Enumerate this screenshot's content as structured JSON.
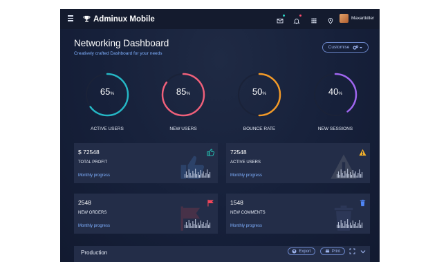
{
  "header": {
    "brand": "Adminux Mobile",
    "username": "Maxartkiller",
    "icons": [
      "menu-icon",
      "trophy-icon",
      "mail-icon",
      "bell-icon",
      "apps-grid-icon",
      "location-pin-icon"
    ],
    "mail_dot_color": "#2dd4c8",
    "bell_dot_color": "#ff4d6d"
  },
  "page": {
    "title": "Networking Dashboard",
    "subtitle": "Creatively crafted Dashboard for your needs",
    "customise_label": "Customise"
  },
  "gauges": [
    {
      "value": "65",
      "unit": "%",
      "label": "ACTIVE USERS",
      "percent": 65,
      "color": "#25b7c5"
    },
    {
      "value": "85",
      "unit": "%",
      "label": "NEW USERS",
      "percent": 85,
      "color": "#f0607a"
    },
    {
      "value": "50",
      "unit": "%",
      "label": "BOUNCE RATE",
      "percent": 50,
      "color": "#f49b28"
    },
    {
      "value": "40",
      "unit": "%",
      "label": "NEW SESSIONS",
      "percent": 40,
      "color": "#a066f0"
    }
  ],
  "cards": [
    {
      "value": "$ 72548",
      "label": "TOTAL PROFIT",
      "progress": "Monthly progress",
      "icon": "thumbs-up-icon",
      "icon_color": "#25c9b8"
    },
    {
      "value": "72548",
      "label": "ACTIVE USERS",
      "progress": "Monthly progress",
      "icon": "warning-icon",
      "icon_color": "#f5b22a"
    },
    {
      "value": "2548",
      "label": "NEW ORDERS",
      "progress": "Monthly progress",
      "icon": "flag-icon",
      "icon_color": "#f0465a"
    },
    {
      "value": "1548",
      "label": "NEW COMMENTS",
      "progress": "Monthly progress",
      "icon": "trash-icon",
      "icon_color": "#4f86f7"
    }
  ],
  "production": {
    "title": "Production",
    "export_label": "Export",
    "print_label": "Print"
  }
}
